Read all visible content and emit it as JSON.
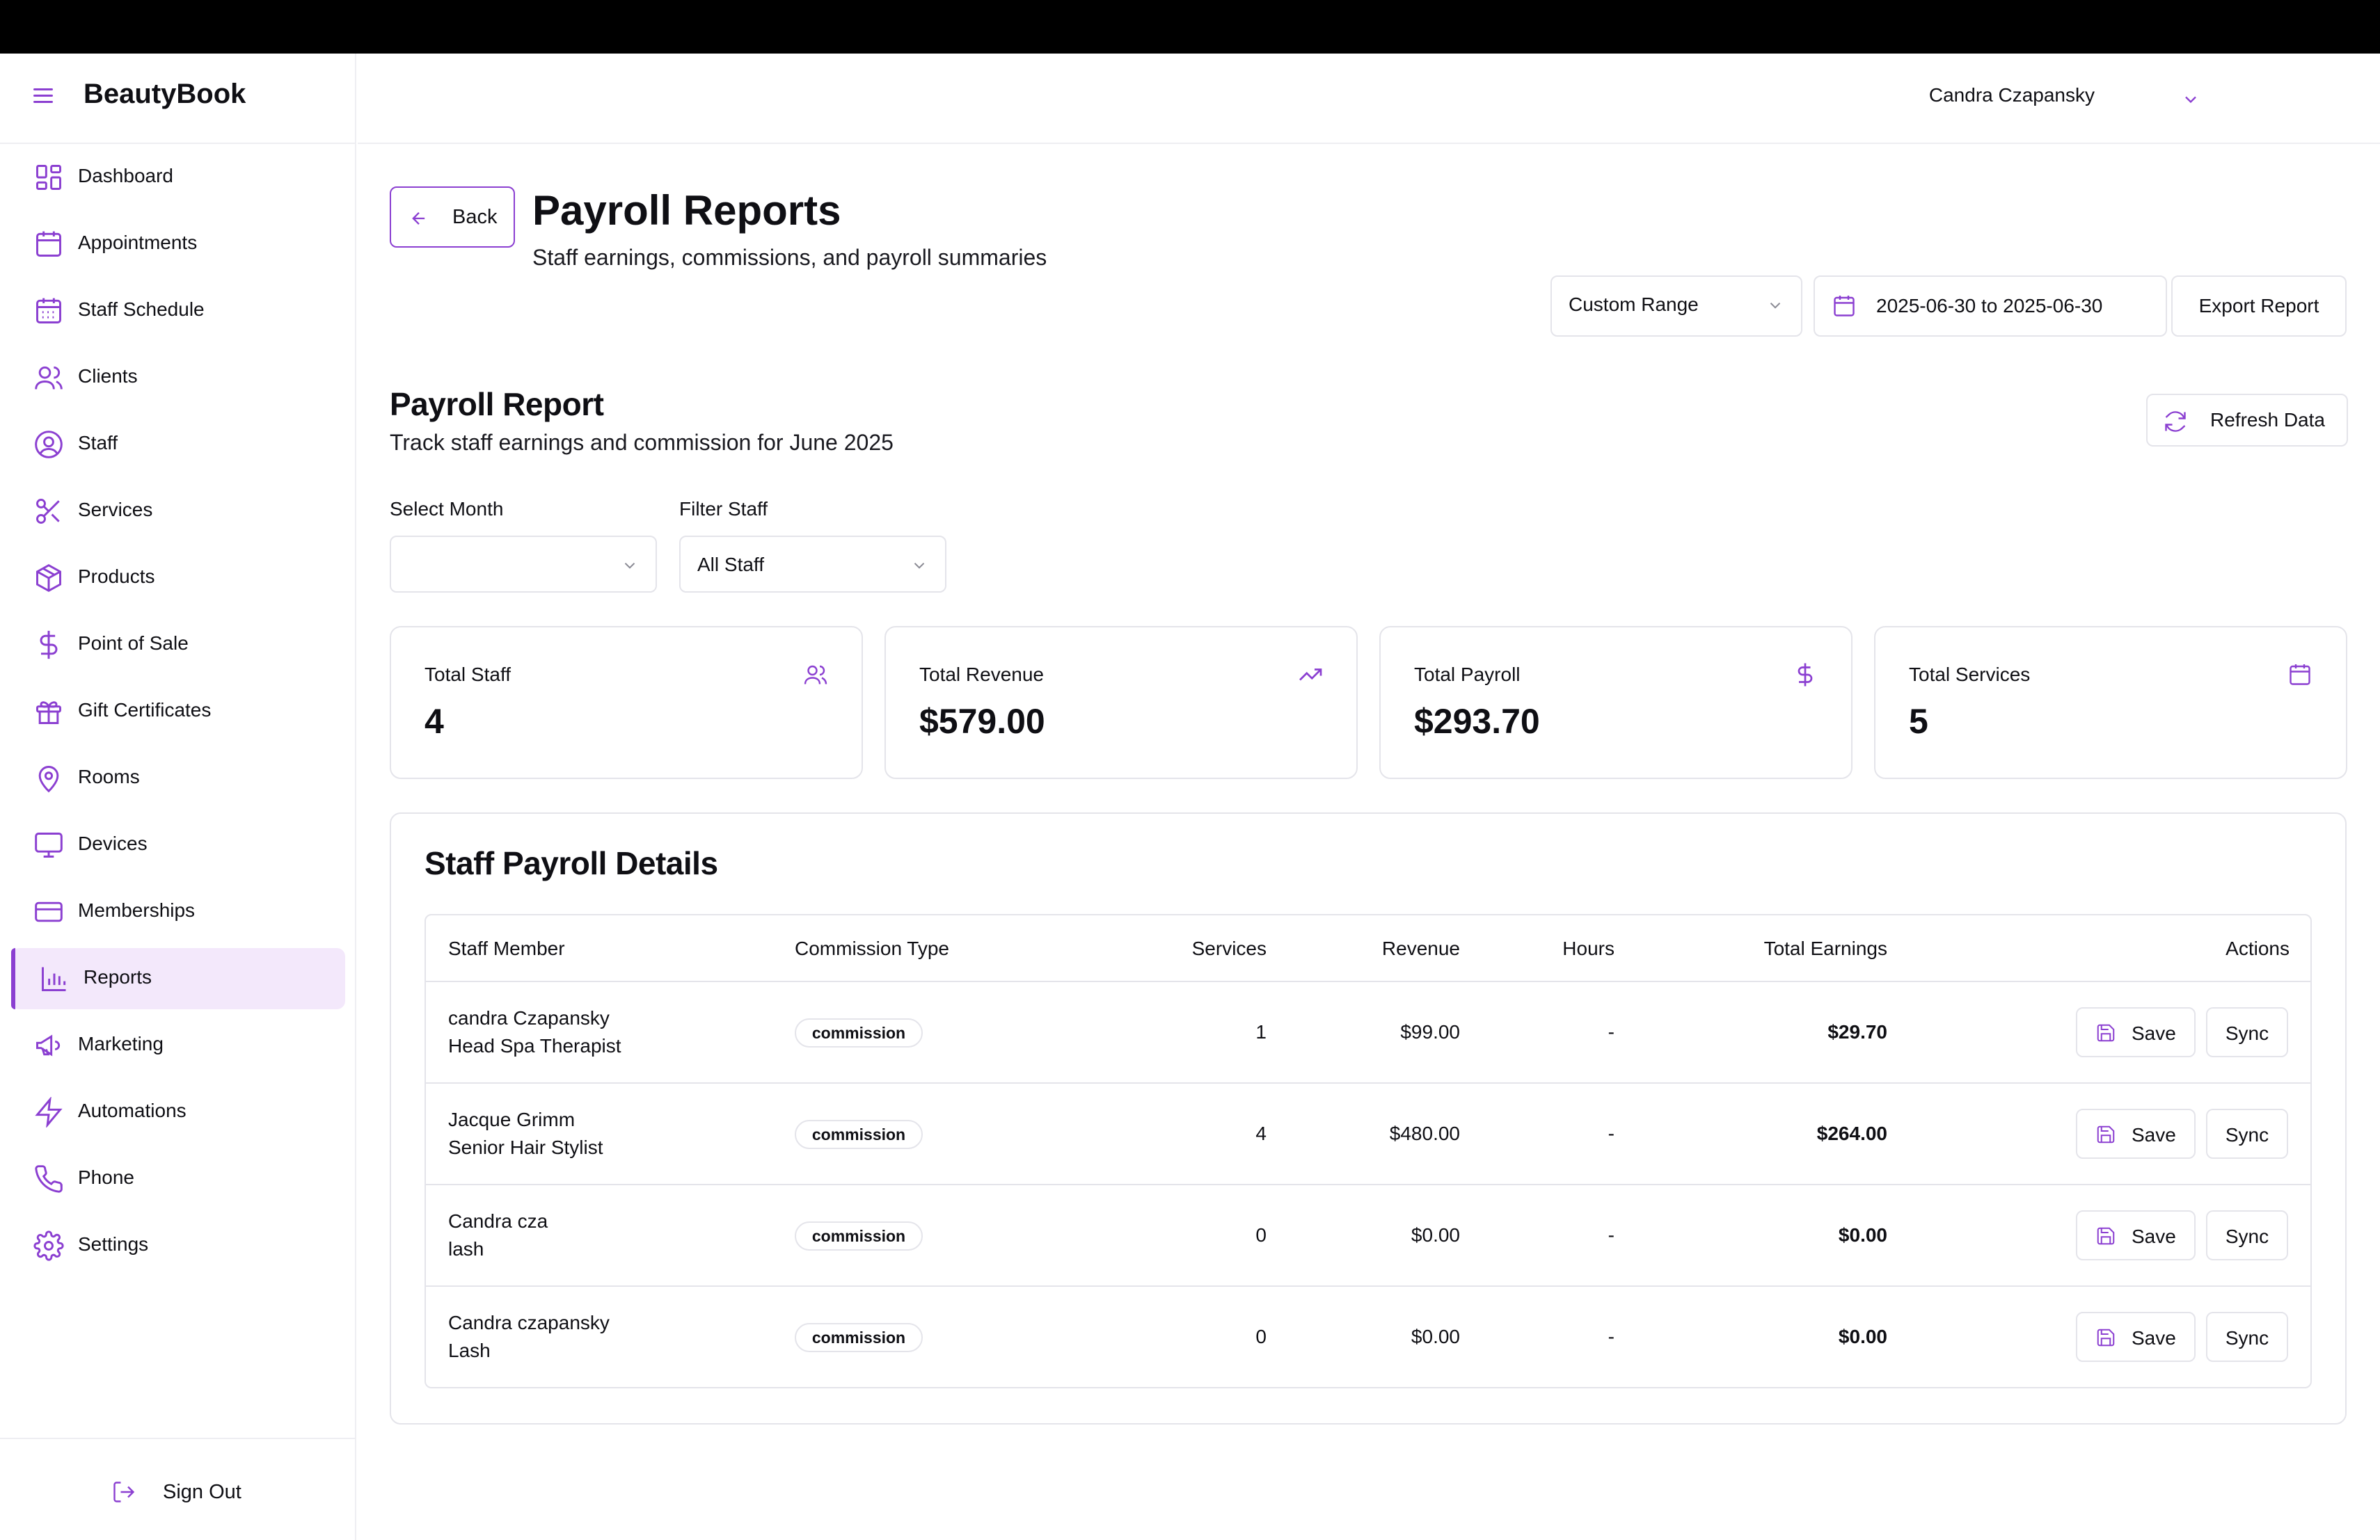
{
  "app": {
    "name": "BeautyBook"
  },
  "sidebar": {
    "items": [
      {
        "label": "Dashboard",
        "icon": "dashboard-icon"
      },
      {
        "label": "Appointments",
        "icon": "calendar-icon"
      },
      {
        "label": "Staff Schedule",
        "icon": "calendar-grid-icon"
      },
      {
        "label": "Clients",
        "icon": "users-icon"
      },
      {
        "label": "Staff",
        "icon": "user-circle-icon"
      },
      {
        "label": "Services",
        "icon": "scissors-icon"
      },
      {
        "label": "Products",
        "icon": "box-icon"
      },
      {
        "label": "Point of Sale",
        "icon": "dollar-icon"
      },
      {
        "label": "Gift Certificates",
        "icon": "gift-icon"
      },
      {
        "label": "Rooms",
        "icon": "map-pin-icon"
      },
      {
        "label": "Devices",
        "icon": "monitor-icon"
      },
      {
        "label": "Memberships",
        "icon": "card-icon"
      },
      {
        "label": "Reports",
        "icon": "bar-chart-icon",
        "active": true
      },
      {
        "label": "Marketing",
        "icon": "megaphone-icon"
      },
      {
        "label": "Automations",
        "icon": "zap-icon"
      },
      {
        "label": "Phone",
        "icon": "phone-icon"
      },
      {
        "label": "Settings",
        "icon": "gear-icon"
      }
    ],
    "sign_out": "Sign Out"
  },
  "header": {
    "user_name": "Candra Czapansky"
  },
  "page": {
    "back_label": "Back",
    "title": "Payroll Reports",
    "subtitle": "Staff earnings, commissions, and payroll summaries",
    "range_select": "Custom Range",
    "date_range": "2025-06-30 to 2025-06-30",
    "export_label": "Export Report"
  },
  "report": {
    "title": "Payroll Report",
    "subtitle": "Track staff earnings and commission for June 2025",
    "refresh_label": "Refresh Data",
    "select_month_label": "Select Month",
    "select_month_value": "",
    "filter_staff_label": "Filter Staff",
    "filter_staff_value": "All Staff"
  },
  "stats": [
    {
      "label": "Total Staff",
      "value": "4",
      "icon": "users-icon"
    },
    {
      "label": "Total Revenue",
      "value": "$579.00",
      "icon": "trending-up-icon"
    },
    {
      "label": "Total Payroll",
      "value": "$293.70",
      "icon": "dollar-icon"
    },
    {
      "label": "Total Services",
      "value": "5",
      "icon": "calendar-icon"
    }
  ],
  "details": {
    "title": "Staff Payroll Details",
    "columns": [
      "Staff Member",
      "Commission Type",
      "Services",
      "Revenue",
      "Hours",
      "Total Earnings",
      "Actions"
    ],
    "save_label": "Save",
    "sync_label": "Sync",
    "rows": [
      {
        "name": "candra Czapansky",
        "role": "Head Spa Therapist",
        "commission": "commission",
        "services": "1",
        "revenue": "$99.00",
        "hours": "-",
        "earnings": "$29.70"
      },
      {
        "name": "Jacque Grimm",
        "role": "Senior Hair Stylist",
        "commission": "commission",
        "services": "4",
        "revenue": "$480.00",
        "hours": "-",
        "earnings": "$264.00"
      },
      {
        "name": "Candra cza",
        "role": "lash",
        "commission": "commission",
        "services": "0",
        "revenue": "$0.00",
        "hours": "-",
        "earnings": "$0.00"
      },
      {
        "name": "Candra czapansky",
        "role": "Lash",
        "commission": "commission",
        "services": "0",
        "revenue": "$0.00",
        "hours": "-",
        "earnings": "$0.00"
      }
    ]
  },
  "colors": {
    "accent": "#8b3fd1",
    "active_bg": "#f3e8fb",
    "border": "#e4e4ea"
  }
}
